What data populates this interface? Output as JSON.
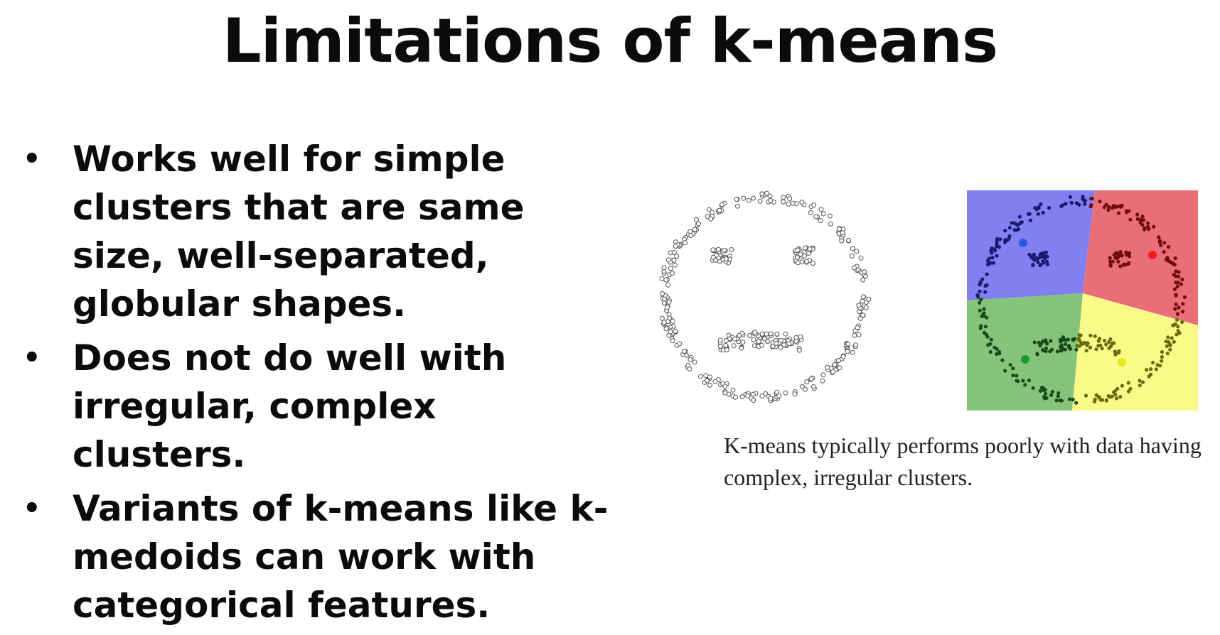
{
  "slide": {
    "title": "Limitations of k-means",
    "bullets": [
      "Works well for simple clusters that are same size, well-separated, globular shapes.",
      "Does not do well with irregular, complex clusters.",
      "Variants of k-means like k-medoids can work with categorical features."
    ],
    "bullet_symbol": "•",
    "caption": "K-means typically performs poorly with data having complex, irregular clusters."
  },
  "figures": {
    "left": {
      "description_icon": "smiley-scatter-unclustered",
      "point_color": "#555555"
    },
    "right": {
      "description_icon": "smiley-scatter-kmeans-4-clusters",
      "region_colors": {
        "blue": "#8080f0",
        "red": "#ea6e78",
        "green": "#86c47c",
        "yellow": "#fafa88"
      },
      "point_colors": {
        "blue": "#1a1a70",
        "red": "#700a10",
        "green": "#1a4a1a",
        "yellow": "#6a6a10"
      },
      "centroid_colors": {
        "blue": "#2b55e0",
        "red": "#ee1c1c",
        "green": "#1a9a2a",
        "yellow": "#e8e820"
      }
    }
  }
}
